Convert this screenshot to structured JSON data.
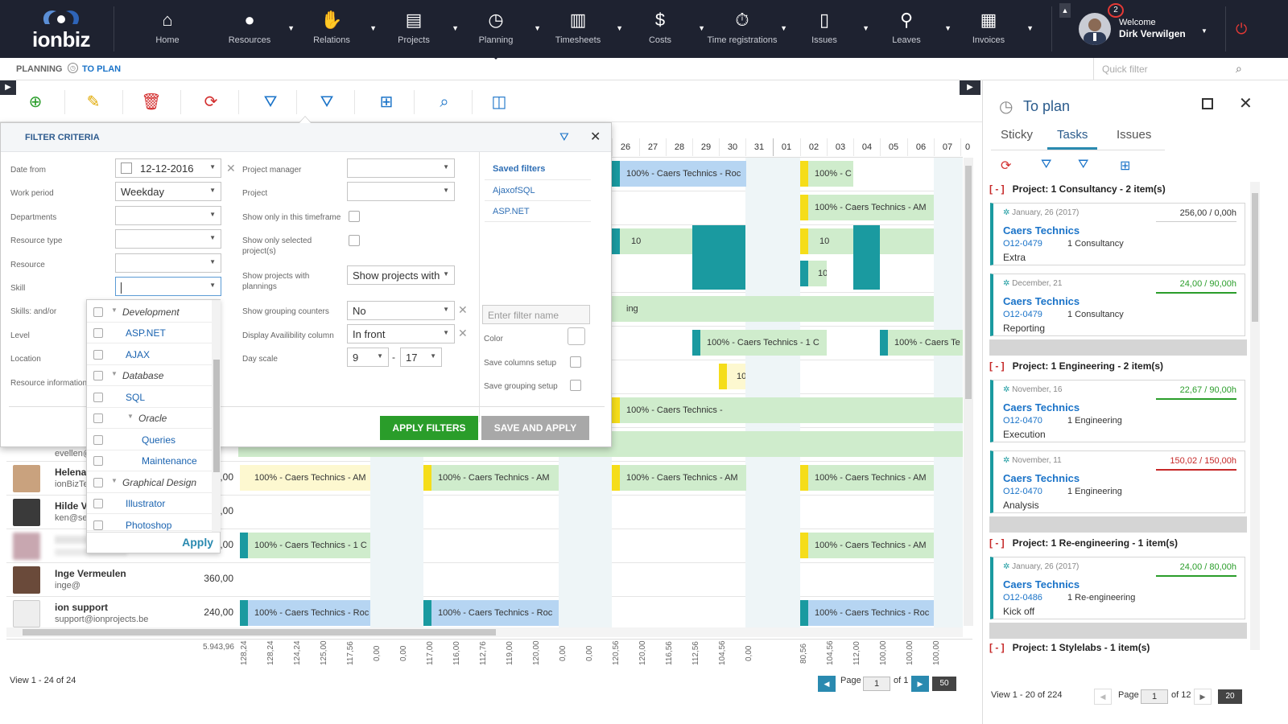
{
  "app": {
    "logo_text": "ionbiz"
  },
  "nav": [
    {
      "label": "Home",
      "icon": "home-icon",
      "dd": false
    },
    {
      "label": "Resources",
      "icon": "user-icon",
      "dd": true
    },
    {
      "label": "Relations",
      "icon": "handshake-icon",
      "dd": true
    },
    {
      "label": "Projects",
      "icon": "folder-icon",
      "dd": true
    },
    {
      "label": "Planning",
      "icon": "clock-icon",
      "dd": true
    },
    {
      "label": "Timesheets",
      "icon": "timesheet-icon",
      "dd": true
    },
    {
      "label": "Costs",
      "icon": "money-bag-icon",
      "dd": true
    },
    {
      "label": "Time registrations",
      "icon": "stopwatch-icon",
      "dd": true
    },
    {
      "label": "Issues",
      "icon": "issue-icon",
      "dd": true
    },
    {
      "label": "Leaves",
      "icon": "walking-icon",
      "dd": true
    },
    {
      "label": "Invoices",
      "icon": "invoice-icon",
      "dd": true
    }
  ],
  "user": {
    "notifications": "2",
    "welcome": "Welcome",
    "name": "Dirk Verwilgen"
  },
  "breadcrumb": {
    "section": "PLANNING",
    "page": "TO PLAN"
  },
  "quick_filter": {
    "placeholder": "Quick filter"
  },
  "filter": {
    "title": "FILTER CRITERIA",
    "labels": {
      "date_from": "Date from",
      "work_period": "Work period",
      "departments": "Departments",
      "resource_type": "Resource type",
      "resource": "Resource",
      "skill": "Skill",
      "skills_andor": "Skills: and/or",
      "level": "Level",
      "location": "Location",
      "resource_information": "Resource information",
      "project_manager": "Project manager",
      "project": "Project",
      "show_only_timeframe": "Show only in this timeframe",
      "show_only_selected": "Show only selected project(s)",
      "show_projects_with_plannings": "Show projects with plannings",
      "show_grouping_counters": "Show grouping counters",
      "display_availability": "Display Availibility column",
      "day_scale": "Day scale",
      "color": "Color",
      "save_columns": "Save columns setup",
      "save_grouping": "Save grouping setup"
    },
    "values": {
      "date_from": "12-12-2016",
      "work_period": "Weekday",
      "show_projects_with": "Show projects with",
      "grouping_counters": "No",
      "availability": "In front",
      "day_scale_from": "9",
      "day_scale_sep": "-",
      "day_scale_to": "17"
    },
    "saved_filters": {
      "title": "Saved filters",
      "items": [
        "AjaxofSQL",
        "ASP.NET"
      ]
    },
    "filter_name_placeholder": "Enter filter name",
    "apply_label": "APPLY FILTERS",
    "save_apply_label": "SAVE AND APPLY"
  },
  "skills": {
    "items": [
      {
        "label": "Development",
        "type": "group",
        "indent": 0
      },
      {
        "label": "ASP.NET",
        "type": "leaf",
        "indent": 1
      },
      {
        "label": "AJAX",
        "type": "leaf",
        "indent": 1
      },
      {
        "label": "Database",
        "type": "group",
        "indent": 0
      },
      {
        "label": "SQL",
        "type": "leaf",
        "indent": 1
      },
      {
        "label": "Oracle",
        "type": "group",
        "indent": 1
      },
      {
        "label": "Queries",
        "type": "leaf",
        "indent": 2
      },
      {
        "label": "Maintenance",
        "type": "leaf",
        "indent": 2
      },
      {
        "label": "Graphical Design",
        "type": "group",
        "indent": 0
      },
      {
        "label": "Illustrator",
        "type": "leaf",
        "indent": 1
      },
      {
        "label": "Photoshop",
        "type": "leaf",
        "indent": 1
      }
    ],
    "apply_label": "Apply"
  },
  "planning": {
    "days": [
      "26",
      "27",
      "28",
      "29",
      "30",
      "31",
      "01",
      "02",
      "03",
      "04",
      "05",
      "06",
      "07",
      "0"
    ],
    "resources": [
      {
        "name": "",
        "email": "evellen@",
        "hours": ""
      },
      {
        "name": "Helena",
        "email": "ionBizTe",
        "hours": ",00"
      },
      {
        "name": "Hilde Ve",
        "email": "ken@se",
        "hours": ",00"
      },
      {
        "name": "",
        "email": "",
        "hours": ",00"
      },
      {
        "name": "Inge Vermeulen",
        "email": "inge@",
        "hours": "360,00"
      },
      {
        "name": "ion support",
        "email": "support@ionprojects.be",
        "hours": "240,00"
      }
    ],
    "bars": {
      "b1": "100% - Caers Technics - Roc",
      "b2": "100% - C",
      "b3": "100% - Caers Technics - AM",
      "b4": "10",
      "b5": "ing",
      "b6": "100% - Caers Technics - 1 C",
      "b7": "100% - Caers Te",
      "b8": "100% - Caers Technics -",
      "b9": "100% - Caers Technics - AM",
      "b10": "100% - Caers Technics - 1 C",
      "b11": "100% - Caers Technics - Roc"
    },
    "total_label": "5.943,96",
    "totals": [
      "128,24",
      "128,24",
      "124,24",
      "125,00",
      "117,56",
      "0,00",
      "0,00",
      "117,00",
      "116,00",
      "112,76",
      "119,00",
      "120,00",
      "0,00",
      "0,00",
      "120,56",
      "120,00",
      "116,56",
      "112,56",
      "104,56",
      "0,00",
      "80,56",
      "104,56",
      "112,00",
      "100,00",
      "100,00",
      "100,00"
    ],
    "view_label": "View 1 - 24 of 24",
    "page_label": "Page",
    "page": "1",
    "of_label": "of 1",
    "page_size": "50"
  },
  "toplan": {
    "title": "To plan",
    "tabs": [
      "Sticky",
      "Tasks",
      "Issues"
    ],
    "groups": [
      {
        "project": "Project: 1 Consultancy - 2 item(s)",
        "cards": [
          {
            "date": "January, 26 (2017)",
            "hours": "256,00 / 0,00h",
            "status": "none",
            "client": "Caers Technics",
            "code": "O12-0479",
            "proj": "1 Consultancy",
            "task": "Extra"
          },
          {
            "date": "December, 21",
            "hours": "24,00 / 90,00h",
            "status": "ok",
            "client": "Caers Technics",
            "code": "O12-0479",
            "proj": "1 Consultancy",
            "task": "Reporting"
          }
        ]
      },
      {
        "project": "Project: 1 Engineering - 2 item(s)",
        "cards": [
          {
            "date": "November, 16",
            "hours": "22,67 / 90,00h",
            "status": "ok",
            "client": "Caers Technics",
            "code": "O12-0470",
            "proj": "1 Engineering",
            "task": "Execution"
          },
          {
            "date": "November, 11",
            "hours": "150,02 / 150,00h",
            "status": "bad",
            "client": "Caers Technics",
            "code": "O12-0470",
            "proj": "1 Engineering",
            "task": "Analysis"
          }
        ]
      },
      {
        "project": "Project: 1 Re-engineering - 1 item(s)",
        "cards": [
          {
            "date": "January, 26 (2017)",
            "hours": "24,00 / 80,00h",
            "status": "ok",
            "client": "Caers Technics",
            "code": "O12-0486",
            "proj": "1 Re-engineering",
            "task": "Kick off"
          }
        ]
      },
      {
        "project": "Project: 1 Stylelabs - 1 item(s)",
        "cards": []
      }
    ],
    "view_label": "View 1 - 20 of 224",
    "page_label": "Page",
    "page": "1",
    "of_label": "of 12",
    "page_size": "20"
  },
  "colors": {
    "nav_bg": "#1e2230",
    "accent": "#2a8ab0",
    "green": "#2a9d2a",
    "red": "#c62828",
    "teal": "#1a9aa0"
  }
}
